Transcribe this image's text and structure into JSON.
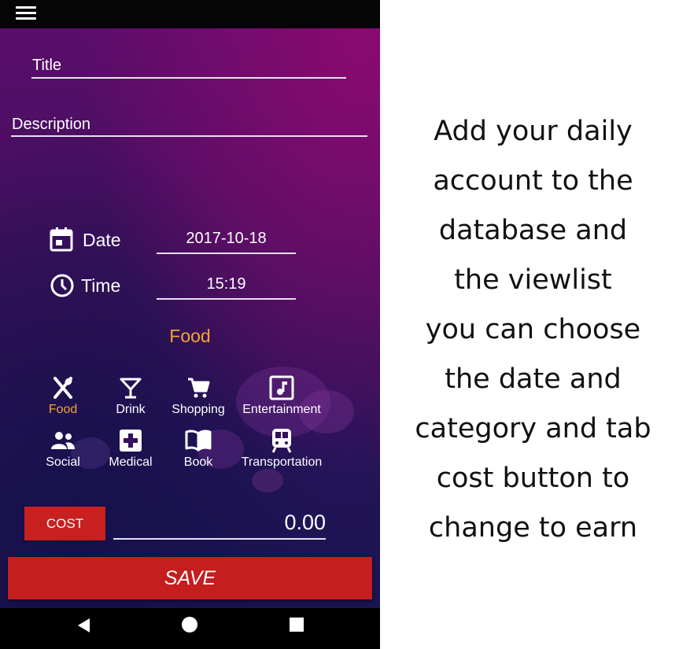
{
  "form": {
    "title_placeholder": "Title",
    "description_placeholder": "Description",
    "date_label": "Date",
    "date_value": "2017-10-18",
    "time_label": "Time",
    "time_value": "15:19",
    "selected_category": "Food"
  },
  "categories": [
    {
      "label": "Food",
      "icon": "fork-knife-icon",
      "active": true
    },
    {
      "label": "Drink",
      "icon": "cocktail-icon",
      "active": false
    },
    {
      "label": "Shopping",
      "icon": "cart-icon",
      "active": false
    },
    {
      "label": "Entertainment",
      "icon": "music-icon",
      "active": false
    },
    {
      "label": "Social",
      "icon": "people-icon",
      "active": false
    },
    {
      "label": "Medical",
      "icon": "medical-cross-icon",
      "active": false
    },
    {
      "label": "Book",
      "icon": "book-icon",
      "active": false
    },
    {
      "label": "Transportation",
      "icon": "train-icon",
      "active": false
    }
  ],
  "cost": {
    "button_label": "COST",
    "amount": "0.00"
  },
  "save_label": "SAVE",
  "caption": {
    "lines": [
      "Add your daily",
      "account to the",
      "database and",
      "the viewlist",
      "you can choose",
      "the date and",
      "category and tab",
      "cost button to",
      "change to earn"
    ]
  },
  "colors": {
    "accent": "#f5a233",
    "button_red": "#c41e1e",
    "background_top": "#5a0d6a",
    "background_bottom": "#1a1450"
  }
}
